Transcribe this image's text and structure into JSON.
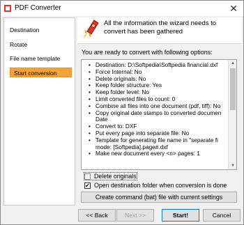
{
  "window": {
    "title": "PDF Converter"
  },
  "sidebar": {
    "items": [
      {
        "label": "Destination",
        "active": false
      },
      {
        "label": "Rotate",
        "active": false
      },
      {
        "label": "File name template",
        "active": false
      },
      {
        "label": "Start conversion",
        "active": true
      }
    ]
  },
  "header": {
    "message": "All the information the wizard needs to convert has been gathered"
  },
  "main": {
    "ready_text": "You are ready to convert with following options:",
    "options": [
      "Destination: D:\\Softpedia\\Softpedia financial.dxf",
      "Force Internal: No",
      "Delete originals: No",
      "Keep folder structure: Yes",
      "Keep folder level: No",
      "Limit converted files to count: 0",
      "Combine all files into one document (pdf, tiff): No",
      "Copy original date stamps to converted documen\nDate",
      "Convert to: DXF",
      "Put every page into separate file: No",
      "Template for generating file name in \"separate fi\nmode: [Softpedia].page#.dxf",
      "Make new document every <n> pages: 1"
    ],
    "delete_originals": {
      "label": "Delete originals",
      "checked": false
    },
    "open_destination": {
      "label": "Open destination folder when conversion is done",
      "checked": true
    },
    "create_batch_label": "Create command (bat) file with current settings"
  },
  "footer": {
    "back_label": "<< Back",
    "next_label": "Next >>",
    "start_label": "Start!",
    "cancel_label": "Cancel"
  }
}
